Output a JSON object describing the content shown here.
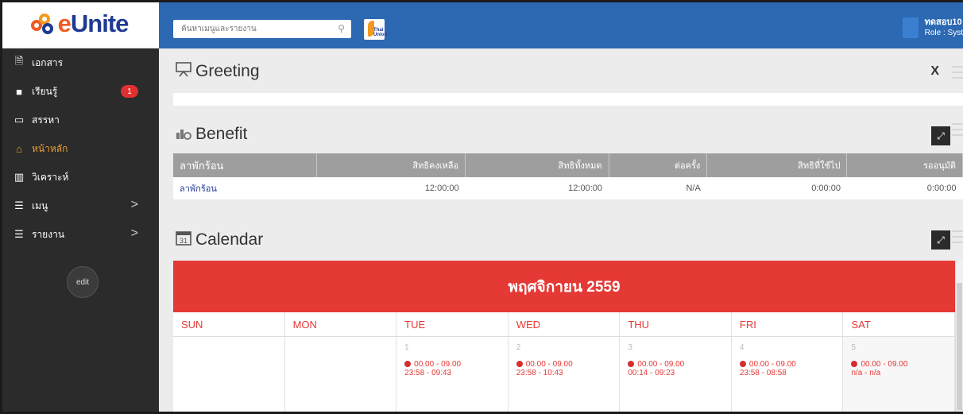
{
  "app": {
    "logo_text_e": "e",
    "logo_text_rest": "Unite"
  },
  "sidebar": {
    "items": [
      {
        "label": "เอกสาร",
        "icon": "document-icon",
        "glyph": "🗎"
      },
      {
        "label": "เรียนรู้",
        "icon": "easel-icon",
        "glyph": "■",
        "badge": "1"
      },
      {
        "label": "สรรหา",
        "icon": "chat-icon",
        "glyph": "▭"
      },
      {
        "label": "หน้าหลัก",
        "icon": "home-icon",
        "glyph": "⌂",
        "active": true
      },
      {
        "label": "วิเคราะห์",
        "icon": "bar-chart-icon",
        "glyph": "▥"
      },
      {
        "label": "เมนู",
        "icon": "list-icon",
        "glyph": "☰",
        "chevron": ">"
      },
      {
        "label": "รายงาน",
        "icon": "list-icon",
        "glyph": "☰",
        "chevron": ">"
      }
    ],
    "edit_label": "edit"
  },
  "topbar": {
    "search_placeholder": "ค้นหาเมนูและรายงาน",
    "company_logo_text": "Thai Union",
    "user_name": "ทดสอบ10",
    "user_role": "Role : Syst"
  },
  "greeting": {
    "title": "Greeting",
    "close_label": "X"
  },
  "benefit": {
    "title": "Benefit",
    "columns": [
      "ลาพักร้อน",
      "สิทธิคงเหลือ",
      "สิทธิทั้งหมด",
      "ต่อครั้ง",
      "สิทธิที่ใช้ไป",
      "รออนุมัติ"
    ],
    "rows": [
      [
        "ลาพักร้อน",
        "12:00:00",
        "12:00:00",
        "N/A",
        "0:00:00",
        "0:00:00"
      ]
    ]
  },
  "calendar": {
    "title": "Calendar",
    "month_label": "พฤศจิกายน 2559",
    "day_headers": [
      "SUN",
      "MON",
      "TUE",
      "WED",
      "THU",
      "FRI",
      "SAT"
    ],
    "cells": [
      {
        "day": "",
        "shift": "",
        "times": ""
      },
      {
        "day": "",
        "shift": "",
        "times": ""
      },
      {
        "day": "1",
        "shift": "00.00 - 09.00",
        "times": "23:58 - 09:43"
      },
      {
        "day": "2",
        "shift": "00.00 - 09.00",
        "times": "23:58 - 10:43"
      },
      {
        "day": "3",
        "shift": "00.00 - 09.00",
        "times": "00:14 - 09:23"
      },
      {
        "day": "4",
        "shift": "00.00 - 09.00",
        "times": "23:58 - 08:58"
      },
      {
        "day": "5",
        "shift": "00.00 - 09.00",
        "times": "n/a - n/a"
      }
    ]
  },
  "colors": {
    "accent_blue": "#2d69b3",
    "sidebar": "#2b2b2b",
    "calendar_red": "#e53935",
    "active_nav": "#f0a030"
  }
}
